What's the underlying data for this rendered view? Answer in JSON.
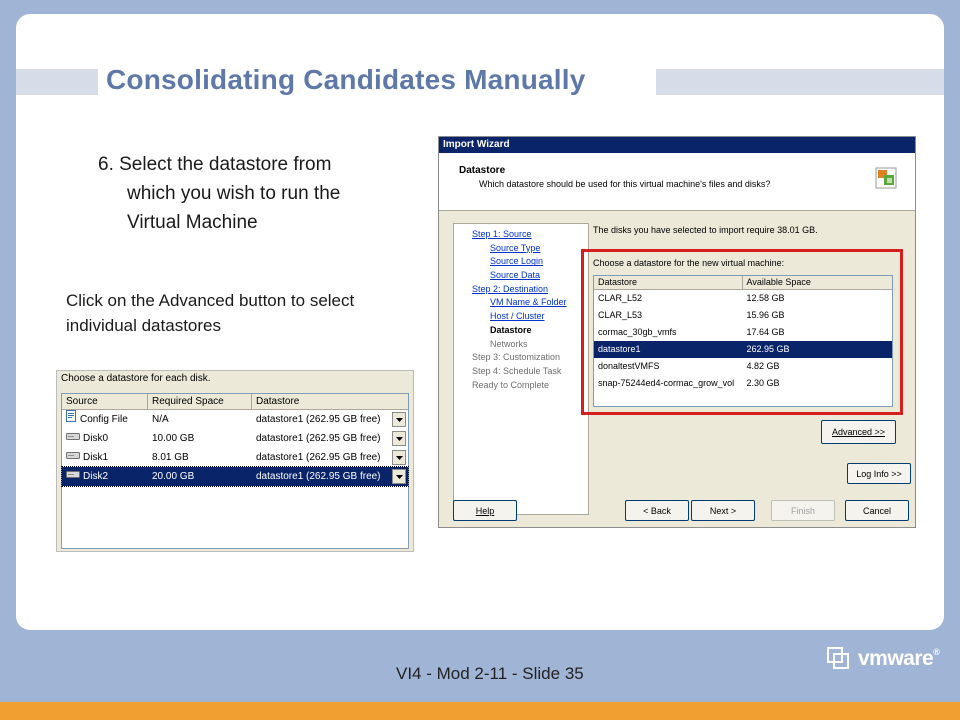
{
  "slide": {
    "title": "Consolidating Candidates Manually",
    "step_lines": [
      "6. Select the datastore from",
      "which you wish to run the",
      "Virtual Machine"
    ],
    "advanced_note_lines": [
      "Click on the Advanced button to select",
      "individual datastores"
    ],
    "footer": "VI4 - Mod 2-11 - Slide   35",
    "logo_text": "vmware",
    "logo_tm": "®"
  },
  "wizard": {
    "window_title": "Import Wizard",
    "header_title": "Datastore",
    "header_subtitle": "Which datastore should be used for this virtual machine's files and disks?",
    "header_icon": "datastore-icon",
    "nav": [
      {
        "label": "Step 1: Source",
        "kind": "step",
        "state": "link"
      },
      {
        "label": "Source Type",
        "kind": "sub",
        "state": "link"
      },
      {
        "label": "Source Login",
        "kind": "sub",
        "state": "link"
      },
      {
        "label": "Source Data",
        "kind": "sub",
        "state": "link"
      },
      {
        "label": "Step 2: Destination",
        "kind": "step",
        "state": "link"
      },
      {
        "label": "VM Name & Folder",
        "kind": "sub",
        "state": "link"
      },
      {
        "label": "Host / Cluster",
        "kind": "sub",
        "state": "link"
      },
      {
        "label": "Datastore",
        "kind": "sub",
        "state": "current"
      },
      {
        "label": "Networks",
        "kind": "sub",
        "state": "future"
      },
      {
        "label": "Step 3: Customization",
        "kind": "step",
        "state": "future"
      },
      {
        "label": "Step 4: Schedule Task",
        "kind": "step",
        "state": "future"
      },
      {
        "label": "Ready to Complete",
        "kind": "step",
        "state": "future"
      }
    ],
    "disk_requirement": "The disks you have selected to import require 38.01 GB.",
    "choose_label": "Choose a datastore for the new virtual machine:",
    "table_headers": {
      "name": "Datastore",
      "space": "Available Space"
    },
    "datastores": [
      {
        "name": "CLAR_L52",
        "space": "12.58 GB",
        "selected": false
      },
      {
        "name": "CLAR_L53",
        "space": "15.96 GB",
        "selected": false
      },
      {
        "name": "cormac_30gb_vmfs",
        "space": "17.64 GB",
        "selected": false
      },
      {
        "name": "datastore1",
        "space": "262.95 GB",
        "selected": true
      },
      {
        "name": "donaltestVMFS",
        "space": "4.82 GB",
        "selected": false
      },
      {
        "name": "snap-75244ed4-cormac_grow_vol",
        "space": "2.30 GB",
        "selected": false
      }
    ],
    "buttons": {
      "advanced": "Advanced >>",
      "log_info": "Log Info >>",
      "help": "Help",
      "back": "< Back",
      "next": "Next >",
      "finish": "Finish",
      "cancel": "Cancel"
    },
    "highlight_color": "#d41f1f"
  },
  "disk_dialog": {
    "label": "Choose a datastore for each disk.",
    "headers": {
      "source": "Source",
      "required": "Required Space",
      "datastore": "Datastore"
    },
    "rows": [
      {
        "source": "Config File",
        "icon": "config-file-icon",
        "required": "N/A",
        "datastore": "datastore1 (262.95 GB free)",
        "selected": false
      },
      {
        "source": "Disk0",
        "icon": "disk-icon",
        "required": "10.00 GB",
        "datastore": "datastore1 (262.95 GB free)",
        "selected": false
      },
      {
        "source": "Disk1",
        "icon": "disk-icon",
        "required": "8.01 GB",
        "datastore": "datastore1 (262.95 GB free)",
        "selected": false
      },
      {
        "source": "Disk2",
        "icon": "disk-icon",
        "required": "20.00 GB",
        "datastore": "datastore1 (262.95 GB free)",
        "selected": true
      }
    ]
  }
}
